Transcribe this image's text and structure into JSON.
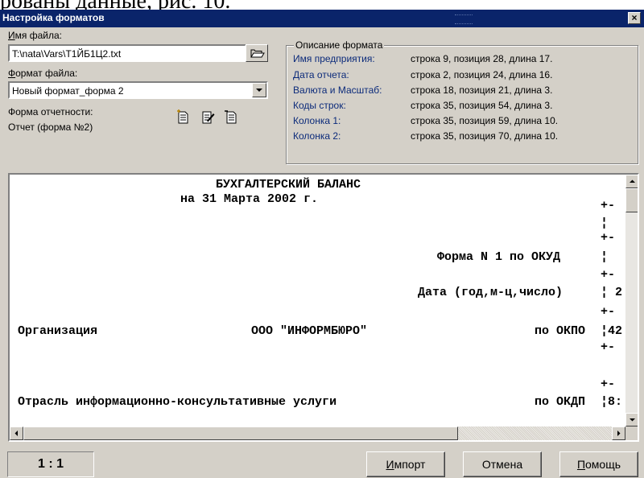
{
  "caption": "рованы данные, рис. 10.",
  "window": {
    "title": "Настройка форматов",
    "close_glyph": "×"
  },
  "file": {
    "label_hot": "И",
    "label_rest": "мя файла:",
    "value": "T:\\nata\\Vars\\Т1ЙБ1Ц2.txt"
  },
  "format": {
    "label_hot": "Ф",
    "label_rest": "ормат файла:",
    "value": "Новый формат_форма 2"
  },
  "report": {
    "label": "Форма отчетности:",
    "value": "Отчет (форма №2)"
  },
  "icons": [
    "new-format-icon",
    "edit-format-icon",
    "delete-format-icon",
    "open-file-icon",
    "dropdown-arrow-icon"
  ],
  "description": {
    "title": "Описание формата",
    "rows": [
      {
        "key": "Имя предприятия:",
        "value": "строка 9, позиция 28, длина 17."
      },
      {
        "key": "Дата отчета:",
        "value": "строка 2, позиция 24, длина 16."
      },
      {
        "key": "Валюта и Масштаб:",
        "value": "строка 18, позиция 21, длина 3."
      },
      {
        "key": "Коды строк:",
        "value": "строка 35, позиция 54, длина 3."
      },
      {
        "key": "Колонка 1:",
        "value": "строка 35, позиция 59, длина 10."
      },
      {
        "key": "Колонка 2:",
        "value": "строка 35, позиция 70, длина 10."
      }
    ]
  },
  "preview": {
    "lines": [
      "БУХГАЛТЕРСКИЙ БАЛАНС",
      "на 31 Марта 2002 г.",
      "Форма N 1 по ОКУД",
      "Дата (год,м-ц,число)",
      "Организация",
      "ООО \"ИНФОРМБЮРО\"",
      "по ОКПО",
      "Отрасль информационно-консультативные услуги",
      "по ОКДП"
    ],
    "right_edge": [
      "+-",
      "¦",
      "+-",
      "¦",
      "+-",
      "¦ 2",
      "+-",
      "¦42",
      "+-",
      "+-",
      "¦8:"
    ]
  },
  "footer": {
    "zoom": "1 : 1",
    "import_hot": "И",
    "import_rest": "мпорт",
    "cancel": "Отмена",
    "help_hot": "П",
    "help_rest": "омощь"
  }
}
